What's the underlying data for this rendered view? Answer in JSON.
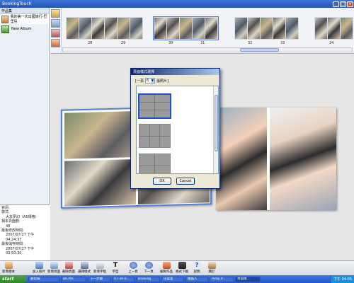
{
  "window": {
    "title": "BookingTouch"
  },
  "left_pane": {
    "header": "作品集",
    "albums": [
      {
        "label": "我的第一次出國旅行-巴里島",
        "selected": true
      },
      {
        "label": "New Album",
        "selected": false
      }
    ]
  },
  "info": {
    "lines": [
      "資訊:",
      "樣式:",
      "大本夢幻（A5規格）",
      "相本頁面數:",
      "48",
      "最後修改時間:",
      "2007/07/27 下午 04:24:37",
      "最後儲存時間:",
      "2007/07/27 下午 03:50:30"
    ]
  },
  "filmstrip": {
    "pages": [
      "28",
      "29",
      "30",
      "31",
      "32",
      "33",
      "34"
    ]
  },
  "dialog": {
    "title": "頁面樣式選擇",
    "per_page_label": "[一頁",
    "per_page_value": "6",
    "photos_suffix": "張照片]",
    "ok_label": "OK",
    "cancel_label": "Cancel"
  },
  "toolbar": {
    "items": [
      "新增相本",
      "加入照片",
      "新增頁面",
      "刪除頁面",
      "選擇樣式",
      "新增字框",
      "字型",
      "上一頁",
      "下一頁",
      "編製作品",
      "格式下載",
      "說明",
      "關於"
    ]
  },
  "taskbar": {
    "start_label": "start",
    "tasks": [
      "數位檔",
      "BICPIK",
      "下一步驟",
      "07-30-0...",
      "Booking",
      "巴里島",
      "機器人",
      "Picky P...",
      "頁面樣..."
    ],
    "clock": "下午 04:05"
  },
  "colors": {
    "accent": "#2453b8",
    "selection": "#5080d8"
  }
}
